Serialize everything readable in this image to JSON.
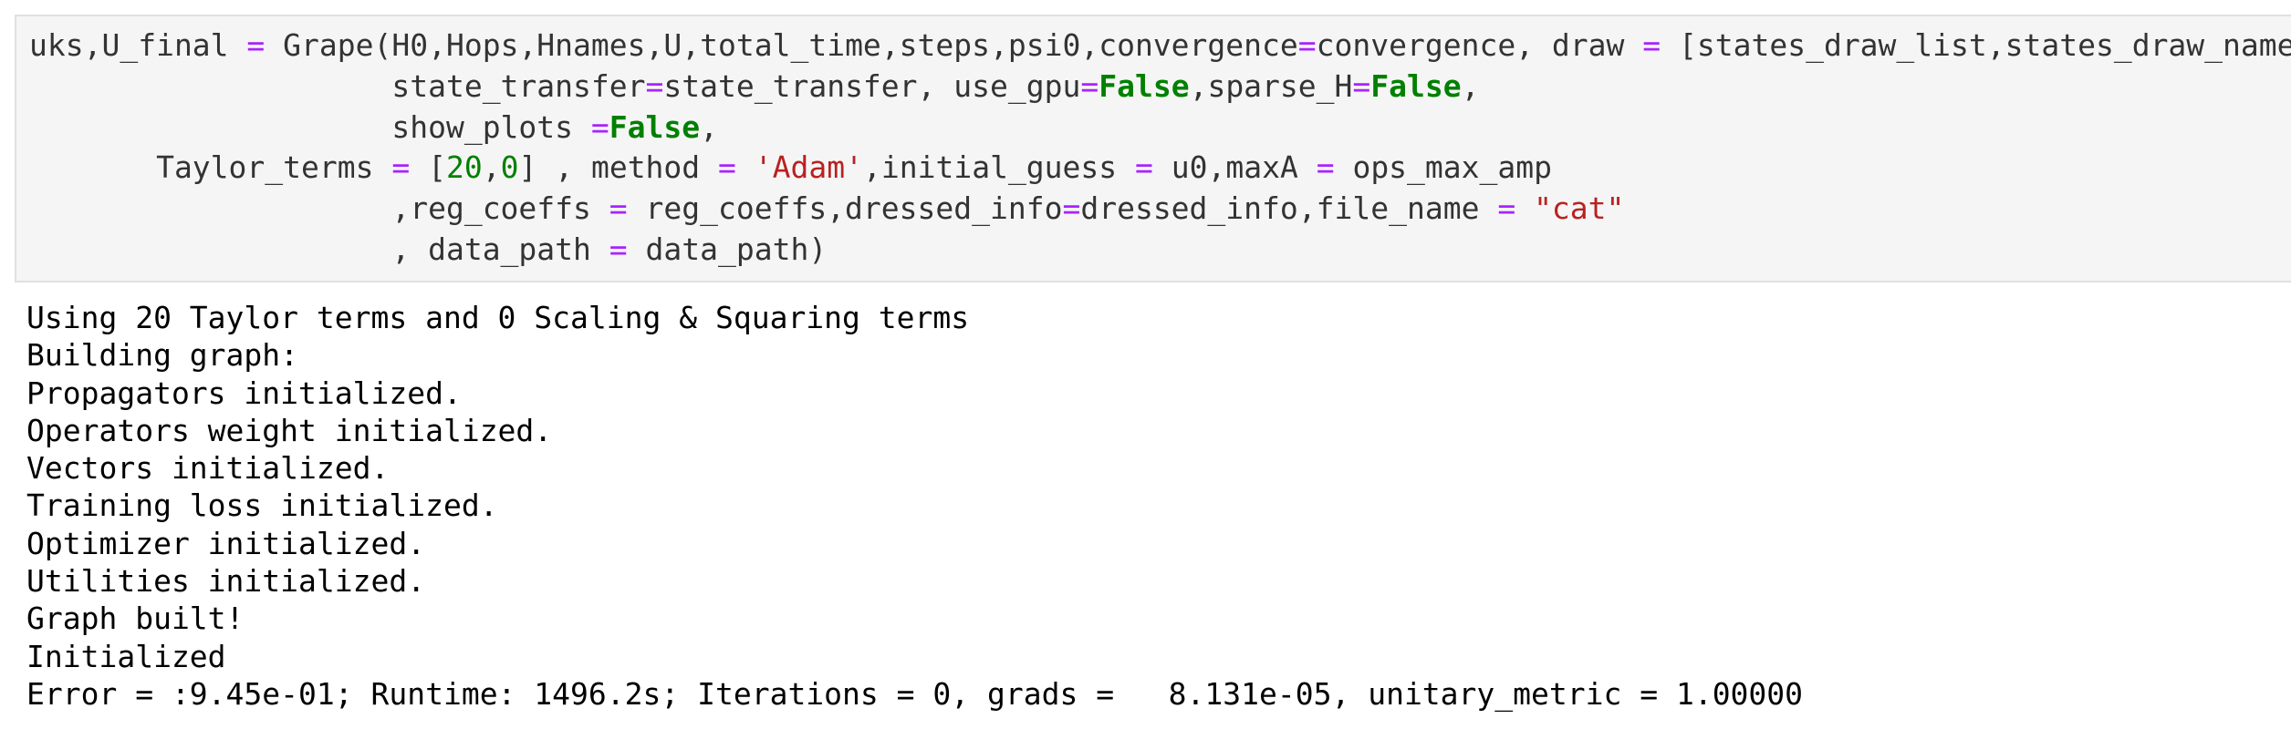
{
  "input_cell": {
    "lines": [
      [
        {
          "t": "uks,U_final ",
          "k": "plain"
        },
        {
          "t": "=",
          "k": "op"
        },
        {
          "t": " Grape(H0,Hops,Hnames,U,total_time,steps,psi0,convergence",
          "k": "plain"
        },
        {
          "t": "=",
          "k": "op"
        },
        {
          "t": "convergence, draw ",
          "k": "plain"
        },
        {
          "t": "=",
          "k": "op"
        },
        {
          "t": " [states_draw_list,states_draw_names],",
          "k": "plain"
        }
      ],
      [
        {
          "t": "                    state_transfer",
          "k": "plain"
        },
        {
          "t": "=",
          "k": "op"
        },
        {
          "t": "state_transfer, use_gpu",
          "k": "plain"
        },
        {
          "t": "=",
          "k": "op"
        },
        {
          "t": "False",
          "k": "kw"
        },
        {
          "t": ",sparse_H",
          "k": "plain"
        },
        {
          "t": "=",
          "k": "op"
        },
        {
          "t": "False",
          "k": "kw"
        },
        {
          "t": ",",
          "k": "plain"
        }
      ],
      [
        {
          "t": "                    show_plots ",
          "k": "plain"
        },
        {
          "t": "=",
          "k": "op"
        },
        {
          "t": "False",
          "k": "kw"
        },
        {
          "t": ",",
          "k": "plain"
        }
      ],
      [
        {
          "t": "       Taylor_terms ",
          "k": "plain"
        },
        {
          "t": "=",
          "k": "op"
        },
        {
          "t": " [",
          "k": "plain"
        },
        {
          "t": "20",
          "k": "num"
        },
        {
          "t": ",",
          "k": "plain"
        },
        {
          "t": "0",
          "k": "num"
        },
        {
          "t": "] , method ",
          "k": "plain"
        },
        {
          "t": "=",
          "k": "op"
        },
        {
          "t": " ",
          "k": "plain"
        },
        {
          "t": "'Adam'",
          "k": "str"
        },
        {
          "t": ",initial_guess ",
          "k": "plain"
        },
        {
          "t": "=",
          "k": "op"
        },
        {
          "t": " u0,maxA ",
          "k": "plain"
        },
        {
          "t": "=",
          "k": "op"
        },
        {
          "t": " ops_max_amp",
          "k": "plain"
        }
      ],
      [
        {
          "t": "                    ,reg_coeffs ",
          "k": "plain"
        },
        {
          "t": "=",
          "k": "op"
        },
        {
          "t": " reg_coeffs,dressed_info",
          "k": "plain"
        },
        {
          "t": "=",
          "k": "op"
        },
        {
          "t": "dressed_info,file_name ",
          "k": "plain"
        },
        {
          "t": "=",
          "k": "op"
        },
        {
          "t": " ",
          "k": "plain"
        },
        {
          "t": "\"cat\"",
          "k": "str"
        }
      ],
      [
        {
          "t": "                    , data_path ",
          "k": "plain"
        },
        {
          "t": "=",
          "k": "op"
        },
        {
          "t": " data_path)",
          "k": "plain"
        }
      ]
    ]
  },
  "output": {
    "lines": [
      "Using 20 Taylor terms and 0 Scaling & Squaring terms",
      "Building graph:",
      "Propagators initialized.",
      "Operators weight initialized.",
      "Vectors initialized.",
      "Training loss initialized.",
      "Optimizer initialized.",
      "Utilities initialized.",
      "Graph built!",
      "Initialized",
      "Error = :9.45e-01; Runtime: 1496.2s; Iterations = 0, grads =   8.131e-05, unitary_metric = 1.00000"
    ]
  }
}
